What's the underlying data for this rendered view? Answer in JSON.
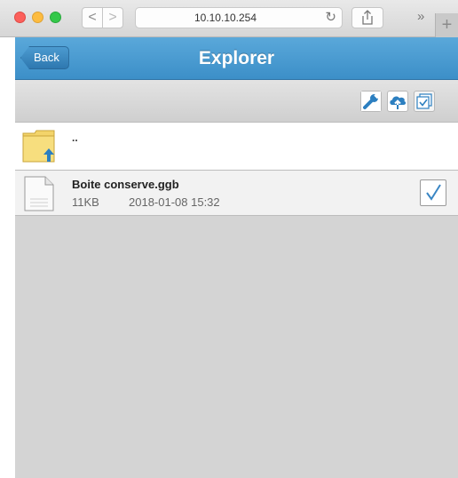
{
  "browser": {
    "url": "10.10.10.254",
    "back_glyph": "<",
    "forward_glyph": ">",
    "reload_glyph": "↻",
    "more_glyph": "»",
    "new_tab_glyph": "+"
  },
  "app": {
    "title": "Explorer",
    "back_label": "Back"
  },
  "toolbar": {
    "icons": [
      "wrench-icon",
      "cloud-upload-icon",
      "select-all-icon"
    ]
  },
  "file_list": {
    "parent": {
      "label": ".."
    },
    "files": [
      {
        "name": "Boite conserve.ggb",
        "size": "11KB",
        "date": "2018-01-08 15:32",
        "checked": true
      }
    ]
  },
  "colors": {
    "header_blue": "#3c8fc8",
    "toolbar_blue": "#2c7fc0",
    "list_background": "#d4d4d4"
  }
}
